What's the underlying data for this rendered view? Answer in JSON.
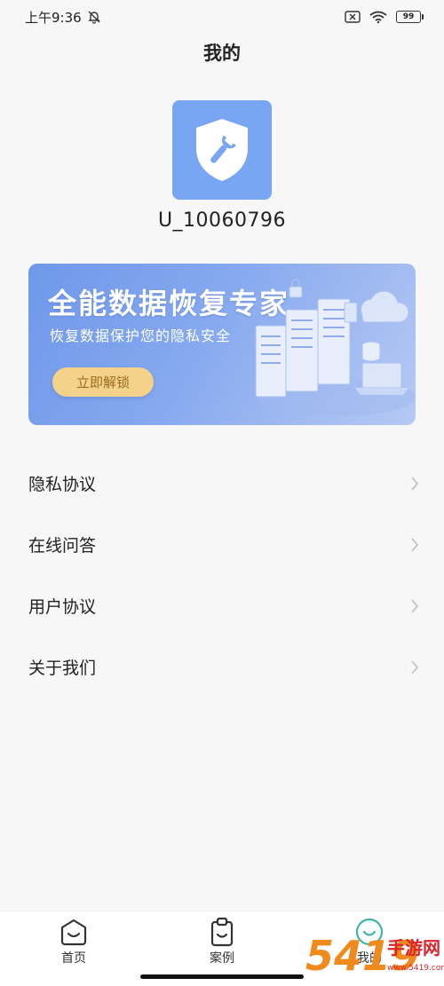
{
  "status_bar": {
    "time": "上午9:36",
    "battery": "99"
  },
  "header": {
    "title": "我的"
  },
  "profile": {
    "avatar_icon": "shield-wrench-icon",
    "username": "U_10060796"
  },
  "banner": {
    "title": "全能数据恢复专家",
    "subtitle": "恢复数据保护您的隐私安全",
    "button_label": "立即解锁"
  },
  "menu": {
    "items": [
      {
        "label": "隐私协议"
      },
      {
        "label": "在线问答"
      },
      {
        "label": "用户协议"
      },
      {
        "label": "关于我们"
      }
    ]
  },
  "tabbar": {
    "tabs": [
      {
        "label": "首页",
        "icon": "home-icon"
      },
      {
        "label": "案例",
        "icon": "clipboard-icon"
      },
      {
        "label": "我的",
        "icon": "smile-icon",
        "active": true
      }
    ]
  },
  "colors": {
    "accent": "#78a6f2",
    "banner_button": "#f4d28a",
    "active_tab": "#3db6a6"
  },
  "watermark": {
    "text": "手游网",
    "digits": "5419",
    "domain": "www.5419.com"
  }
}
